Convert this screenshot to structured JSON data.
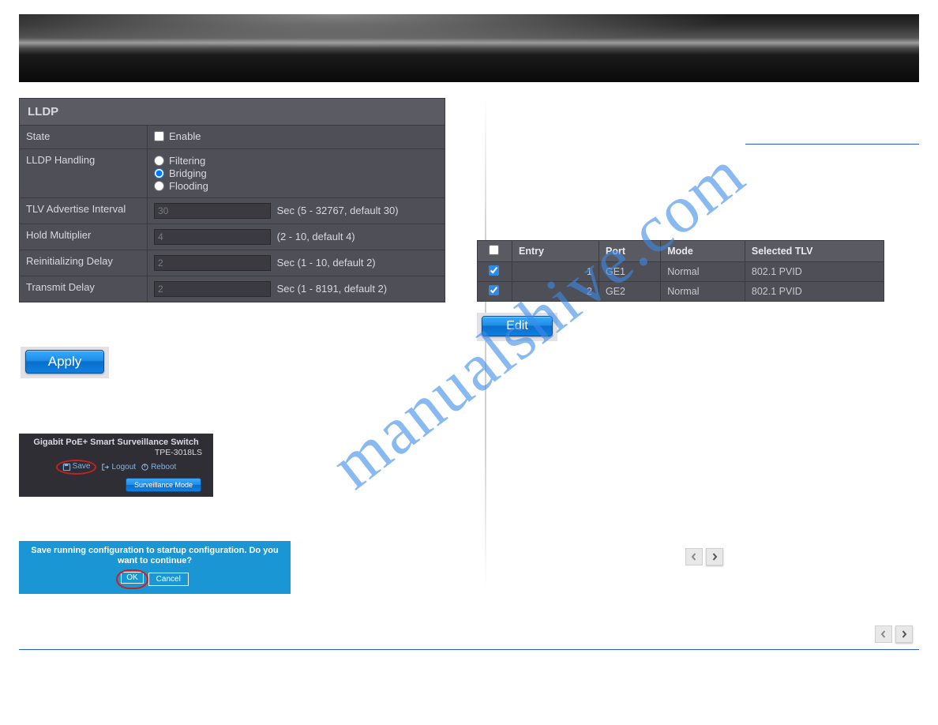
{
  "lldp": {
    "title": "LLDP",
    "state_label": "State",
    "state_option": "Enable",
    "state_checked": false,
    "handling_label": "LLDP Handling",
    "handling_options": {
      "filtering": "Filtering",
      "bridging": "Bridging",
      "flooding": "Flooding"
    },
    "handling_selected": "bridging",
    "tlv_label": "TLV Advertise Interval",
    "tlv_value": "30",
    "tlv_hint": "Sec (5 - 32767, default 30)",
    "hold_label": "Hold Multiplier",
    "hold_value": "4",
    "hold_hint": "(2 - 10, default 4)",
    "reinit_label": "Reinitializing Delay",
    "reinit_value": "2",
    "reinit_hint": "Sec (1 - 10, default 2)",
    "tx_label": "Transmit Delay",
    "tx_value": "2",
    "tx_hint": "Sec (1 - 8191, default 2)"
  },
  "buttons": {
    "apply": "Apply",
    "edit": "Edit"
  },
  "device": {
    "title": "Gigabit PoE+ Smart Surveillance Switch",
    "model": "TPE-3018LS",
    "save": "Save",
    "logout": "Logout",
    "reboot": "Reboot",
    "mode": "Surveillance Mode"
  },
  "confirm": {
    "text": "Save running configuration to startup configuration. Do you want to continue?",
    "ok": "OK",
    "cancel": "Cancel"
  },
  "port_table": {
    "select_all": false,
    "headers": {
      "entry": "Entry",
      "port": "Port",
      "mode": "Mode",
      "tlv": "Selected TLV"
    },
    "rows": [
      {
        "checked": true,
        "entry": "1",
        "port": "GE1",
        "mode": "Normal",
        "tlv": "802.1 PVID"
      },
      {
        "checked": true,
        "entry": "2",
        "port": "GE2",
        "mode": "Normal",
        "tlv": "802.1 PVID"
      }
    ]
  },
  "watermark": "manualshive.com"
}
